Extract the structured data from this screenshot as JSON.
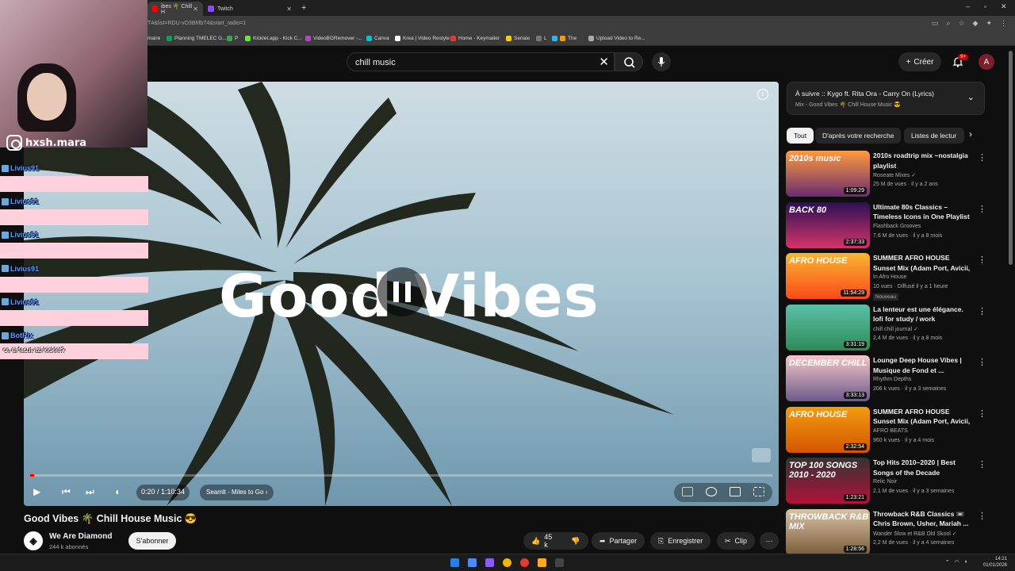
{
  "browser": {
    "tabs": [
      {
        "label": "ibes 🌴 Chill H",
        "active": true
      },
      {
        "label": "Twitch",
        "active": false
      }
    ],
    "url": "T4&list=RDU-vO3BhfbT4&start_radio=1",
    "bookmarks": [
      "maire",
      "Planning TMELEC G...",
      "P",
      "Kicklet.app - Kick C...",
      "VideoBGRemover -...",
      "Canva",
      "Krea | Video Restyle",
      "Home - Keymailer",
      "Seriale",
      "L",
      "The",
      "Upload Video to Re..."
    ]
  },
  "header": {
    "search_value": "chill music",
    "create_label": "Créer",
    "notif_count": "9+",
    "avatar_letter": "A"
  },
  "player": {
    "overlay_title": "Good Vibes",
    "time": "0:20 / 1:10:34",
    "chapter": "Seamlt - Miles to Go",
    "progress_fraction": 0.005
  },
  "video": {
    "title": "Good Vibes 🌴 Chill House Music 😎",
    "channel": "We Are Diamond",
    "subscribers": "244 k abonnés",
    "subscribe_label": "S'abonner",
    "likes": "45 k",
    "share_label": "Partager",
    "save_label": "Enregistrer",
    "clip_label": "Clip"
  },
  "upnext": {
    "title": "À suivre :: Kygo ft. Rita Ora - Carry On (Lyrics)",
    "subtitle": "Mix - Good Vibes 🌴 Chill House Music 😎"
  },
  "chips": [
    "Tout",
    "D'après votre recherche",
    "Listes de lectur"
  ],
  "recommendations": [
    {
      "title": "2010s roadtrip mix ~nostalgia playlist",
      "channel": "Roseate Mixes ✓",
      "meta": "25 M de vues · il y a 2 ans",
      "duration": "1:09:29",
      "thumb_text": "2010s music",
      "badge": ""
    },
    {
      "title": "Ultimate 80s Classics – Timeless Icons in One Playlist",
      "channel": "Flashback Grooves",
      "meta": "7,6 M de vues · il y a 8 mois",
      "duration": "2:37:33",
      "thumb_text": "BACK 80",
      "badge": ""
    },
    {
      "title": "SUMMER AFRO HOUSE Sunset Mix (Adam Port, Avicii, The ...",
      "channel": "In Afro House",
      "meta": "10 vues · Diffusé il y a 1 heure",
      "duration": "11:54:29",
      "thumb_text": "AFRO HOUSE",
      "badge": "Nouveau"
    },
    {
      "title": "La lenteur est une élégance. lofi for study / work",
      "channel": "chill chill journal ✓",
      "meta": "2,4 M de vues · il y a 8 mois",
      "duration": "3:31:19",
      "thumb_text": "",
      "badge": ""
    },
    {
      "title": "Lounge Deep House Vibes | Musique de Fond et ...",
      "channel": "Rhythm Depths",
      "meta": "206 k vues · il y a 3 semaines",
      "duration": "3:33:13",
      "thumb_text": "DECEMBER CHILL",
      "badge": ""
    },
    {
      "title": "SUMMER AFRO HOUSE Sunset Mix (Adam Port, Avicii, The ...",
      "channel": "AFRO BEATS",
      "meta": "960 k vues · il y a 4 mois",
      "duration": "2:32:54",
      "thumb_text": "AFRO HOUSE",
      "badge": ""
    },
    {
      "title": "Top Hits 2010–2020 | Best Songs of the Decade",
      "channel": "Relic Noir",
      "meta": "2,1 M de vues · il y a 3 semaines",
      "duration": "1:23:21",
      "thumb_text": "TOP 100 SONGS 2010 - 2020",
      "badge": ""
    },
    {
      "title": "Throwback R&B Classics 📼 Chris Brown, Usher, Mariah ...",
      "channel": "Wander Slow et R&B Old Skool ✓",
      "meta": "2,2 M de vues · il y a 4 semaines",
      "duration": "1:28:56",
      "thumb_text": "THROWBACK R&B MIX",
      "badge": ""
    }
  ],
  "stream": {
    "instagram": "hxsh.mara",
    "chat": [
      {
        "name": "Livius91",
        "msg": ""
      },
      {
        "name": "Livius91",
        "msg": ""
      },
      {
        "name": "Livius91",
        "msg": ""
      },
      {
        "name": "Livius91",
        "msg": ""
      },
      {
        "name": "Livius91",
        "msg": ""
      },
      {
        "name": "BotRix",
        "msg": "ce ai facut azi kicklet?"
      }
    ]
  },
  "taskbar": {
    "time": "14:21",
    "date": "01/01/2026"
  }
}
